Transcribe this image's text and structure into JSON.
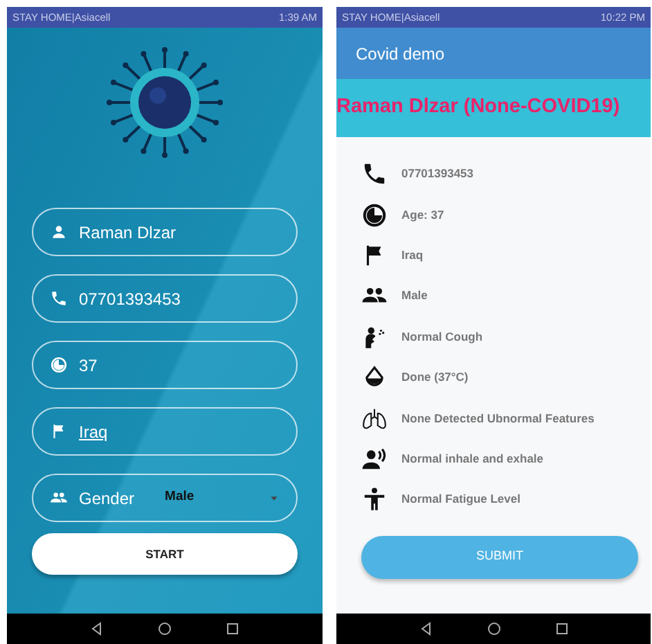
{
  "left_phone": {
    "status_bar": {
      "carrier": "STAY HOME|Asiacell",
      "time": "1:39 AM"
    },
    "fields": [
      {
        "kind": "name",
        "value": "Raman Dlzar"
      },
      {
        "kind": "phone",
        "value": "07701393453"
      },
      {
        "kind": "age",
        "value": "37"
      },
      {
        "kind": "country",
        "value": "Iraq"
      },
      {
        "kind": "gender",
        "label": "Gender",
        "value": "Male"
      }
    ],
    "start_button": "START"
  },
  "right_phone": {
    "status_bar": {
      "carrier": "STAY HOME|Asiacell",
      "time": "10:22 PM"
    },
    "app_bar": {
      "title": "Covid demo"
    },
    "banner": "Raman Dlzar (None-COVID19)",
    "details": [
      {
        "kind": "phone",
        "text": "07701393453"
      },
      {
        "kind": "age",
        "text": "Age: 37"
      },
      {
        "kind": "country",
        "text": "Iraq"
      },
      {
        "kind": "gender",
        "text": "Male"
      },
      {
        "kind": "cough",
        "text": "Normal Cough"
      },
      {
        "kind": "temperature",
        "text": "Done (37°C)"
      },
      {
        "kind": "lungs",
        "text": "None Detected Ubnormal Features"
      },
      {
        "kind": "breathing",
        "text": "Normal inhale and exhale"
      },
      {
        "kind": "fatigue",
        "text": "Normal Fatigue Level"
      }
    ],
    "submit_button": "SUBMIT"
  }
}
